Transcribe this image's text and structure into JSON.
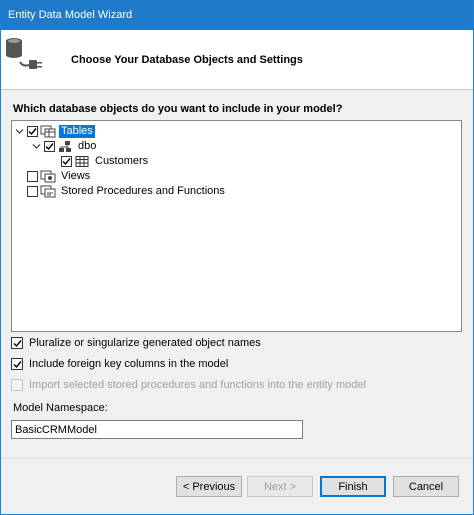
{
  "window": {
    "title": "Entity Data Model Wizard"
  },
  "header": {
    "title": "Choose Your Database Objects and Settings",
    "icon": "database-connect-icon"
  },
  "question": "Which database objects do you want to include in your model?",
  "tree": [
    {
      "id": "tables",
      "label": "Tables",
      "checked": true,
      "expanded": true,
      "selected": true,
      "icon": "tables-icon"
    },
    {
      "id": "dbo",
      "label": "dbo",
      "checked": true,
      "expanded": true,
      "selected": false,
      "icon": "schema-icon"
    },
    {
      "id": "customers",
      "label": "Customers",
      "checked": true,
      "selected": false,
      "icon": "table-icon"
    },
    {
      "id": "views",
      "label": "Views",
      "checked": false,
      "selected": false,
      "icon": "views-icon"
    },
    {
      "id": "procs",
      "label": "Stored Procedures and Functions",
      "checked": false,
      "selected": false,
      "icon": "procedures-icon"
    }
  ],
  "options": {
    "pluralize": {
      "label": "Pluralize or singularize generated object names",
      "checked": true,
      "enabled": true
    },
    "foreign_keys": {
      "label": "Include foreign key columns in the model",
      "checked": true,
      "enabled": true
    },
    "import_procs": {
      "label": "Import selected stored procedures and functions into the entity model",
      "checked": false,
      "enabled": false
    }
  },
  "namespace": {
    "label": "Model Namespace:",
    "value": "BasicCRMModel"
  },
  "buttons": {
    "previous": "< Previous",
    "next": "Next >",
    "finish": "Finish",
    "cancel": "Cancel"
  },
  "colors": {
    "titlebar": "#1f7ac9",
    "selection": "#0078d7"
  }
}
